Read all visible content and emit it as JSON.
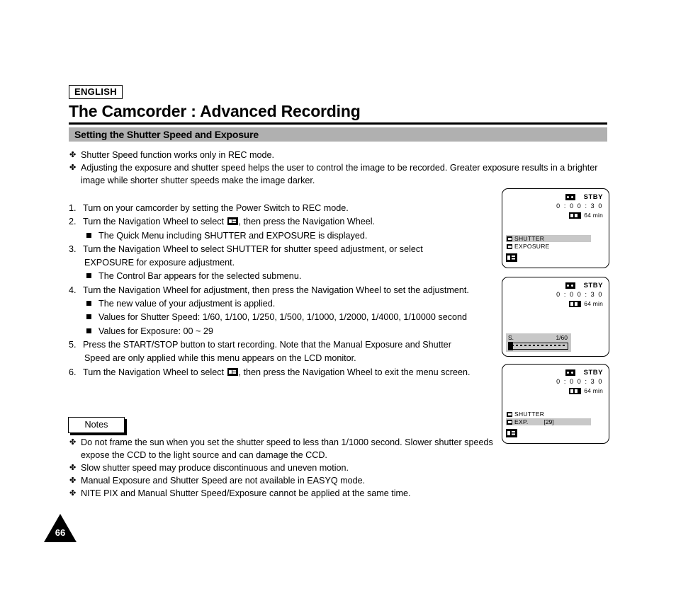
{
  "header": {
    "language_badge": "ENGLISH",
    "title": "The Camcorder : Advanced Recording",
    "section_title": "Setting the Shutter Speed and Exposure"
  },
  "intro_bullets": [
    "Shutter Speed function works only in REC mode.",
    "Adjusting the exposure and shutter speed helps the user to control the image to be recorded. Greater exposure results in a brighter image while shorter shutter speeds make the image darker."
  ],
  "steps": {
    "s1_num": "1.",
    "s1_text": "Turn on your camcorder by setting the Power Switch to REC mode.",
    "s2_num": "2.",
    "s2_text_before": "Turn the Navigation Wheel to select",
    "s2_text_after": ", then press the Navigation Wheel.",
    "s2_sub": "The Quick Menu including  SHUTTER  and  EXPOSURE  is displayed.",
    "s3_num": "3.",
    "s3_text": "Turn the Navigation Wheel to select SHUTTER for shutter speed adjustment, or select",
    "s3_text_line2": "EXPOSURE  for exposure adjustment.",
    "s3_sub": "The Control Bar appears for the selected submenu.",
    "s4_num": "4.",
    "s4_text": "Turn the Navigation Wheel for adjustment, then press the Navigation Wheel to set the adjustment.",
    "s4_sub1": "The new value of your adjustment is applied.",
    "s4_sub2": "Values for Shutter Speed: 1/60, 1/100, 1/250, 1/500, 1/1000, 1/2000, 1/4000, 1/10000 second",
    "s4_sub3": "Values for Exposure: 00 ~ 29",
    "s5_num": "5.",
    "s5_text": "Press the START/STOP button to start recording. Note that the Manual Exposure and Shutter",
    "s5_text_line2": "Speed are only applied while this menu appears on the LCD monitor.",
    "s6_num": "6.",
    "s6_text_before": "Turn the Navigation Wheel to select",
    "s6_text_after": ", then press the Navigation Wheel to exit the menu screen."
  },
  "notes": {
    "badge": "Notes",
    "items": [
      "Do not frame the sun when you set the shutter speed to less than 1/1000 second. Slower shutter speeds expose the CCD to the light source and can damage the CCD.",
      "Slow shutter speed may produce discontinuous and uneven motion.",
      "Manual Exposure and Shutter Speed are not available in EASYQ mode.",
      "NITE PIX and Manual Shutter Speed/Exposure cannot be applied at the same time."
    ]
  },
  "page_number": "66",
  "lcd_common": {
    "status": "STBY",
    "timecode": "0 : 0 0 : 3 0",
    "battery_time": "64 min",
    "tape_icon": "tape-icon",
    "battery_icon": "battery-icon"
  },
  "lcd_panels": [
    {
      "id": "lcd-panel-quick-menu",
      "menu": [
        {
          "label": "SHUTTER",
          "value": "",
          "highlighted": true
        },
        {
          "label": "EXPOSURE",
          "value": "",
          "highlighted": false
        }
      ],
      "exit_icon": "quick-menu-exit-icon",
      "control_bar": null
    },
    {
      "id": "lcd-panel-control-bar",
      "menu": [],
      "exit_icon": null,
      "control_bar": {
        "label": "S.",
        "value": "1/60"
      }
    },
    {
      "id": "lcd-panel-exposure",
      "menu": [
        {
          "label": "SHUTTER",
          "value": "",
          "highlighted": false
        },
        {
          "label": "EXP.",
          "value": "[29]",
          "highlighted": true
        }
      ],
      "exit_icon": "quick-menu-exit-icon",
      "control_bar": null
    }
  ],
  "colors": {
    "section_bar": "#b0b0b0",
    "osd_highlight": "#c8c8c8",
    "ink": "#000000",
    "paper": "#ffffff"
  },
  "glyphs": {
    "clover_bullet": "✤",
    "square_bullet": "square"
  }
}
